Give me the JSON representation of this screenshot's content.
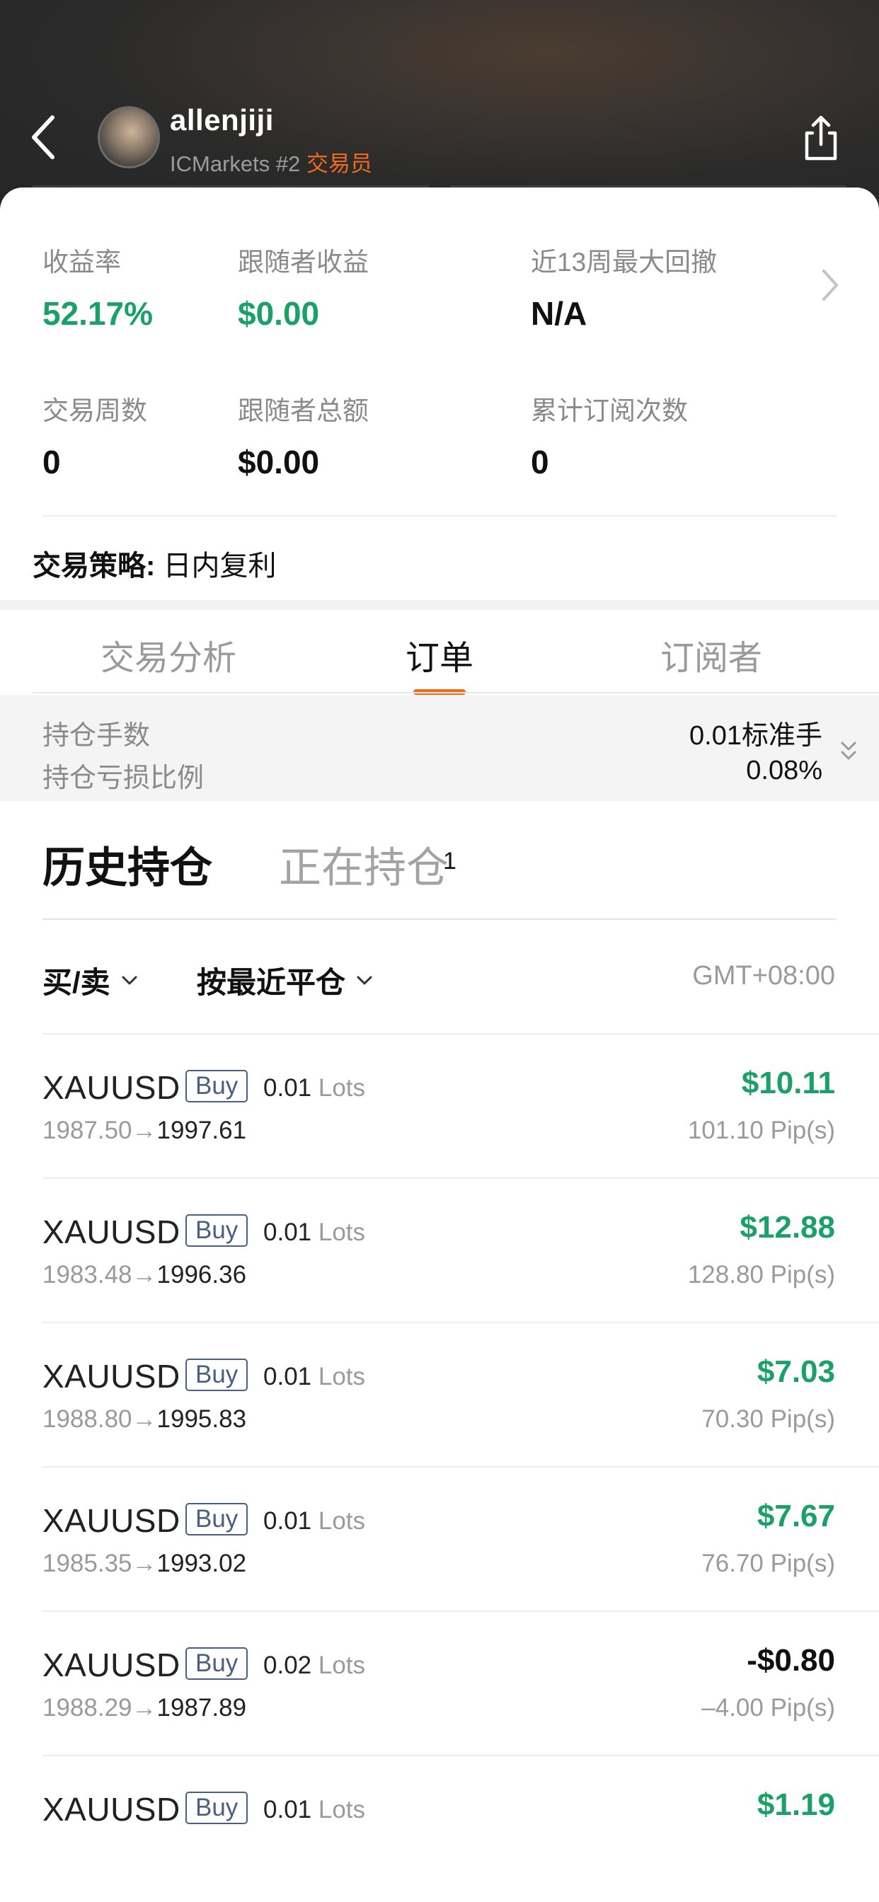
{
  "header": {
    "username": "allenjiji",
    "broker": "ICMarkets #2",
    "role": "交易员",
    "back_icon": "chevron-left-icon",
    "share_icon": "share-icon"
  },
  "stats": {
    "return_rate": {
      "label": "收益率",
      "value": "52.17%"
    },
    "follower_profit": {
      "label": "跟随者收益",
      "value": "$0.00"
    },
    "max_drawdown": {
      "label": "近13周最大回撤",
      "value": "N/A"
    },
    "trading_weeks": {
      "label": "交易周数",
      "value": "0"
    },
    "follower_total": {
      "label": "跟随者总额",
      "value": "$0.00"
    },
    "subscriptions": {
      "label": "累计订阅次数",
      "value": "0"
    },
    "strategy_key": "交易策略:",
    "strategy_value": " 日内复利"
  },
  "tabs": [
    {
      "label": "交易分析",
      "active": false
    },
    {
      "label": "订单",
      "active": true
    },
    {
      "label": "订阅者",
      "active": false
    }
  ],
  "position_summary": {
    "lots_label": "持仓手数",
    "lots_value": "0.01标准手",
    "loss_ratio_label": "持仓亏损比例",
    "loss_ratio_value": "0.08%"
  },
  "sub_tabs": {
    "history": "历史持仓",
    "open": "正在持仓",
    "open_count": "1"
  },
  "filters": {
    "side": "买/卖",
    "sort": "按最近平仓",
    "timezone": "GMT+08:00"
  },
  "orders": [
    {
      "symbol": "XAUUSD",
      "side": "Buy",
      "lots": "0.01",
      "lots_unit": "Lots",
      "open_price": "1987.50",
      "arrow": "→",
      "close_price": "1997.61",
      "profit": "$10.11",
      "pips": "101.10 Pip(s)"
    },
    {
      "symbol": "XAUUSD",
      "side": "Buy",
      "lots": "0.01",
      "lots_unit": "Lots",
      "open_price": "1983.48",
      "arrow": "→",
      "close_price": "1996.36",
      "profit": "$12.88",
      "pips": "128.80 Pip(s)"
    },
    {
      "symbol": "XAUUSD",
      "side": "Buy",
      "lots": "0.01",
      "lots_unit": "Lots",
      "open_price": "1988.80",
      "arrow": "→",
      "close_price": "1995.83",
      "profit": "$7.03",
      "pips": "70.30 Pip(s)"
    },
    {
      "symbol": "XAUUSD",
      "side": "Buy",
      "lots": "0.01",
      "lots_unit": "Lots",
      "open_price": "1985.35",
      "arrow": "→",
      "close_price": "1993.02",
      "profit": "$7.67",
      "pips": "76.70 Pip(s)"
    },
    {
      "symbol": "XAUUSD",
      "side": "Buy",
      "lots": "0.02",
      "lots_unit": "Lots",
      "open_price": "1988.29",
      "arrow": "→",
      "close_price": "1987.89",
      "profit": "-$0.80",
      "pips": "–4.00 Pip(s)"
    },
    {
      "symbol": "XAUUSD",
      "side": "Buy",
      "lots": "0.01",
      "lots_unit": "Lots",
      "open_price": "",
      "arrow": "",
      "close_price": "",
      "profit": "$1.19",
      "pips": ""
    }
  ],
  "colors": {
    "accent": "#f06a1f",
    "profit_green": "#1aa068",
    "buy_tag": "#4b5f84"
  }
}
